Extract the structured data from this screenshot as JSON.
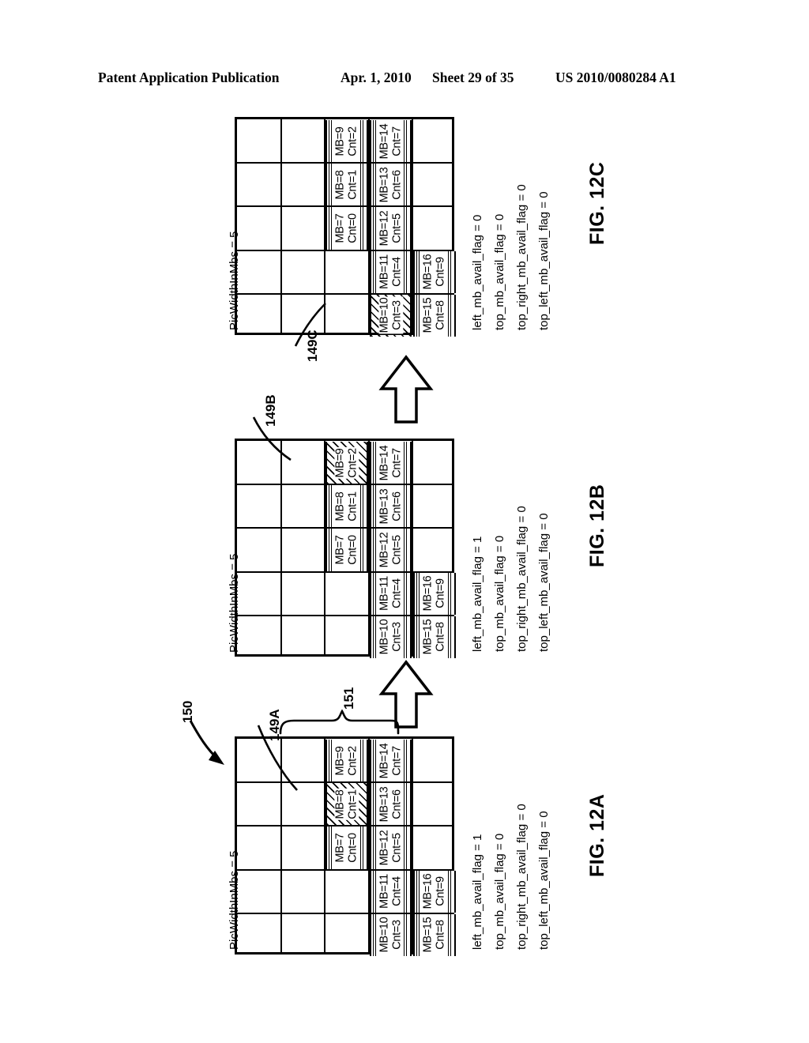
{
  "header": {
    "publication": "Patent Application Publication",
    "date": "Apr. 1, 2010",
    "sheet": "Sheet 29 of 35",
    "number": "US 2010/0080284 A1"
  },
  "common": {
    "pic_width_label": "PicWidthInMbs = 5",
    "grid_cols": 5,
    "grid_rows": 5,
    "system_ref": "150",
    "bracket_ref": "151"
  },
  "figures": [
    {
      "id": "fig12a",
      "label": "FIG. 12A",
      "ref": "149A",
      "pic_width_label": "PicWidthInMbs = 5",
      "current_mb": "MB=8",
      "cells": [
        {
          "mb": "MB=7",
          "cnt": "Cnt=0",
          "col": 2,
          "row": 2,
          "hatched": false
        },
        {
          "mb": "MB=8",
          "cnt": "Cnt=1",
          "col": 2,
          "row": 3,
          "hatched": true
        },
        {
          "mb": "MB=9",
          "cnt": "Cnt=2",
          "col": 2,
          "row": 4,
          "hatched": false
        },
        {
          "mb": "MB=10",
          "cnt": "Cnt=3",
          "col": 3,
          "row": 0,
          "hatched": false
        },
        {
          "mb": "MB=11",
          "cnt": "Cnt=4",
          "col": 3,
          "row": 1,
          "hatched": false
        },
        {
          "mb": "MB=12",
          "cnt": "Cnt=5",
          "col": 3,
          "row": 2,
          "hatched": false
        },
        {
          "mb": "MB=13",
          "cnt": "Cnt=6",
          "col": 3,
          "row": 3,
          "hatched": false
        },
        {
          "mb": "MB=14",
          "cnt": "Cnt=7",
          "col": 3,
          "row": 4,
          "hatched": false
        },
        {
          "mb": "MB=15",
          "cnt": "Cnt=8",
          "col": 4,
          "row": 0,
          "hatched": false
        },
        {
          "mb": "MB=16",
          "cnt": "Cnt=9",
          "col": 4,
          "row": 1,
          "hatched": false
        }
      ],
      "flags": [
        "left_mb_avail_flag = 1",
        "top_mb_avail_flag = 0",
        "top_right_mb_avail_flag = 0",
        "top_left_mb_avail_flag = 0"
      ]
    },
    {
      "id": "fig12b",
      "label": "FIG. 12B",
      "ref": "149B",
      "pic_width_label": "PicWidthInMbs = 5",
      "current_mb": "MB=9",
      "cells": [
        {
          "mb": "MB=7",
          "cnt": "Cnt=0",
          "col": 2,
          "row": 2,
          "hatched": false
        },
        {
          "mb": "MB=8",
          "cnt": "Cnt=1",
          "col": 2,
          "row": 3,
          "hatched": false
        },
        {
          "mb": "MB=9",
          "cnt": "Cnt=2",
          "col": 2,
          "row": 4,
          "hatched": true
        },
        {
          "mb": "MB=10",
          "cnt": "Cnt=3",
          "col": 3,
          "row": 0,
          "hatched": false
        },
        {
          "mb": "MB=11",
          "cnt": "Cnt=4",
          "col": 3,
          "row": 1,
          "hatched": false
        },
        {
          "mb": "MB=12",
          "cnt": "Cnt=5",
          "col": 3,
          "row": 2,
          "hatched": false
        },
        {
          "mb": "MB=13",
          "cnt": "Cnt=6",
          "col": 3,
          "row": 3,
          "hatched": false
        },
        {
          "mb": "MB=14",
          "cnt": "Cnt=7",
          "col": 3,
          "row": 4,
          "hatched": false
        },
        {
          "mb": "MB=15",
          "cnt": "Cnt=8",
          "col": 4,
          "row": 0,
          "hatched": false
        },
        {
          "mb": "MB=16",
          "cnt": "Cnt=9",
          "col": 4,
          "row": 1,
          "hatched": false
        }
      ],
      "flags": [
        "left_mb_avail_flag = 1",
        "top_mb_avail_flag = 0",
        "top_right_mb_avail_flag = 0",
        "top_left_mb_avail_flag = 0"
      ]
    },
    {
      "id": "fig12c",
      "label": "FIG. 12C",
      "ref": "149C",
      "pic_width_label": "PicWidthInMbs = 5",
      "current_mb": "MB=10",
      "cells": [
        {
          "mb": "MB=7",
          "cnt": "Cnt=0",
          "col": 2,
          "row": 2,
          "hatched": false
        },
        {
          "mb": "MB=8",
          "cnt": "Cnt=1",
          "col": 2,
          "row": 3,
          "hatched": false
        },
        {
          "mb": "MB=9",
          "cnt": "Cnt=2",
          "col": 2,
          "row": 4,
          "hatched": false
        },
        {
          "mb": "MB=10",
          "cnt": "Cnt=3",
          "col": 3,
          "row": 0,
          "hatched": true
        },
        {
          "mb": "MB=11",
          "cnt": "Cnt=4",
          "col": 3,
          "row": 1,
          "hatched": false
        },
        {
          "mb": "MB=12",
          "cnt": "Cnt=5",
          "col": 3,
          "row": 2,
          "hatched": false
        },
        {
          "mb": "MB=13",
          "cnt": "Cnt=6",
          "col": 3,
          "row": 3,
          "hatched": false
        },
        {
          "mb": "MB=14",
          "cnt": "Cnt=7",
          "col": 3,
          "row": 4,
          "hatched": false
        },
        {
          "mb": "MB=15",
          "cnt": "Cnt=8",
          "col": 4,
          "row": 0,
          "hatched": false
        },
        {
          "mb": "MB=16",
          "cnt": "Cnt=9",
          "col": 4,
          "row": 1,
          "hatched": false
        }
      ],
      "flags": [
        "left_mb_avail_flag = 0",
        "top_mb_avail_flag = 0",
        "top_right_mb_avail_flag = 0",
        "top_left_mb_avail_flag = 0"
      ]
    }
  ]
}
